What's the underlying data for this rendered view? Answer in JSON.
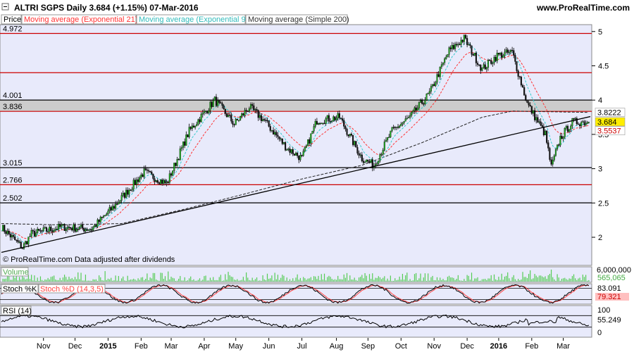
{
  "header": {
    "title": "ALTRI SGPS   Daily   3.684 (+1.15%)   07-Mar-2016",
    "site": "www.ProRealTime.com"
  },
  "legend": {
    "price": "Price",
    "ema21": "Moving average (Exponential 21)",
    "ema9": "Moving average (Exponential 9)",
    "sma200": "Moving average (Simple 200)"
  },
  "footnote": "© ProRealTime.com  Data adjusted after dividends",
  "colors": {
    "up": "#22aa22",
    "down": "#111111",
    "ema21": "#ff3333",
    "ema9": "#33cccc",
    "sma200": "#222222",
    "hline_red": "#cc0000",
    "hline_black": "#000000",
    "zone_fill": "#cccccc",
    "volume": "#55cc55",
    "stoch_k": "#000000",
    "stoch_d": "#ff4444",
    "rsi": "#000000",
    "panel_bg": "#e8eafb"
  },
  "chart_data": {
    "type": "line",
    "price_axis": {
      "ticks": [
        2,
        2.5,
        3,
        3.5,
        4,
        4.5,
        5
      ],
      "tick_labels": [
        "2",
        "2.5",
        "3",
        "3.5",
        "4",
        "4.5",
        "5"
      ],
      "ylim": [
        1.6,
        5.09
      ]
    },
    "x_months": [
      {
        "label": "Nov",
        "day": 28
      },
      {
        "label": "Dec",
        "day": 49
      },
      {
        "label": "2015",
        "day": 71,
        "bold": true
      },
      {
        "label": "Feb",
        "day": 93
      },
      {
        "label": "Mar",
        "day": 113
      },
      {
        "label": "Apr",
        "day": 135
      },
      {
        "label": "May",
        "day": 156
      },
      {
        "label": "Jun",
        "day": 178
      },
      {
        "label": "Jul",
        "day": 200
      },
      {
        "label": "Aug",
        "day": 223
      },
      {
        "label": "Sep",
        "day": 244
      },
      {
        "label": "Oct",
        "day": 266
      },
      {
        "label": "Nov",
        "day": 288
      },
      {
        "label": "Dec",
        "day": 310
      },
      {
        "label": "2016",
        "day": 331,
        "bold": true
      },
      {
        "label": "Feb",
        "day": 353
      },
      {
        "label": "Mar",
        "day": 374
      }
    ],
    "price_keypoints": [
      [
        0,
        2.15
      ],
      [
        14,
        1.85
      ],
      [
        20,
        2.05
      ],
      [
        40,
        2.15
      ],
      [
        60,
        2.12
      ],
      [
        75,
        2.45
      ],
      [
        95,
        2.95
      ],
      [
        110,
        2.78
      ],
      [
        125,
        3.55
      ],
      [
        142,
        4.0
      ],
      [
        155,
        3.65
      ],
      [
        165,
        3.9
      ],
      [
        175,
        3.7
      ],
      [
        190,
        3.3
      ],
      [
        200,
        3.15
      ],
      [
        210,
        3.7
      ],
      [
        225,
        3.75
      ],
      [
        240,
        3.15
      ],
      [
        248,
        3.05
      ],
      [
        260,
        3.55
      ],
      [
        272,
        3.75
      ],
      [
        285,
        4.1
      ],
      [
        298,
        4.72
      ],
      [
        308,
        4.9
      ],
      [
        320,
        4.45
      ],
      [
        330,
        4.65
      ],
      [
        340,
        4.7
      ],
      [
        350,
        3.95
      ],
      [
        362,
        3.5
      ],
      [
        366,
        3.02
      ],
      [
        372,
        3.45
      ],
      [
        380,
        3.68
      ]
    ],
    "horizontal_levels": [
      {
        "value": 4.972,
        "label": "4.972",
        "color": "red"
      },
      {
        "value": 4.4,
        "label": "",
        "color": "red"
      },
      {
        "value": 4.001,
        "label": "4.001",
        "color": "black"
      },
      {
        "value": 3.836,
        "label": "3.836",
        "color": "red"
      },
      {
        "value": 3.015,
        "label": "3.015",
        "color": "black"
      },
      {
        "value": 2.766,
        "label": "2.766",
        "color": "red"
      },
      {
        "value": 2.502,
        "label": "2.502",
        "color": "black"
      }
    ],
    "trendline": {
      "from": [
        0,
        1.78
      ],
      "to": [
        392,
        3.76
      ]
    },
    "sma200_keypoints": [
      [
        0,
        2.2
      ],
      [
        40,
        2.18
      ],
      [
        80,
        2.2
      ],
      [
        120,
        2.4
      ],
      [
        160,
        2.62
      ],
      [
        200,
        2.85
      ],
      [
        240,
        3.05
      ],
      [
        280,
        3.38
      ],
      [
        320,
        3.75
      ],
      [
        340,
        3.84
      ],
      [
        392,
        3.82
      ]
    ],
    "value_labels": [
      {
        "value": 3.8222,
        "label": "3.8222",
        "bg": "#ffffff",
        "fg": "#000000"
      },
      {
        "value": 3.684,
        "label": "3.684",
        "bg": "#ffee00",
        "fg": "#000000"
      },
      {
        "value": 3.5537,
        "label": "3.5537",
        "bg": "#ffffff",
        "fg": "#cc0000"
      }
    ],
    "volume": {
      "label": "Volume",
      "value_label": "565,065",
      "max_tick": "6,000,000"
    },
    "stochastic": {
      "label_k": "Stoch %K",
      "label_d": "Stoch %D (14,3,5)",
      "value_k": "83.091",
      "value_d": "79.321",
      "levels": [
        20,
        80
      ]
    },
    "rsi": {
      "label": "RSI (14)",
      "value_label": "55.249",
      "ticks": [
        0,
        100
      ],
      "tick_labels": [
        "0",
        "100"
      ],
      "levels": [
        30,
        70
      ]
    }
  }
}
